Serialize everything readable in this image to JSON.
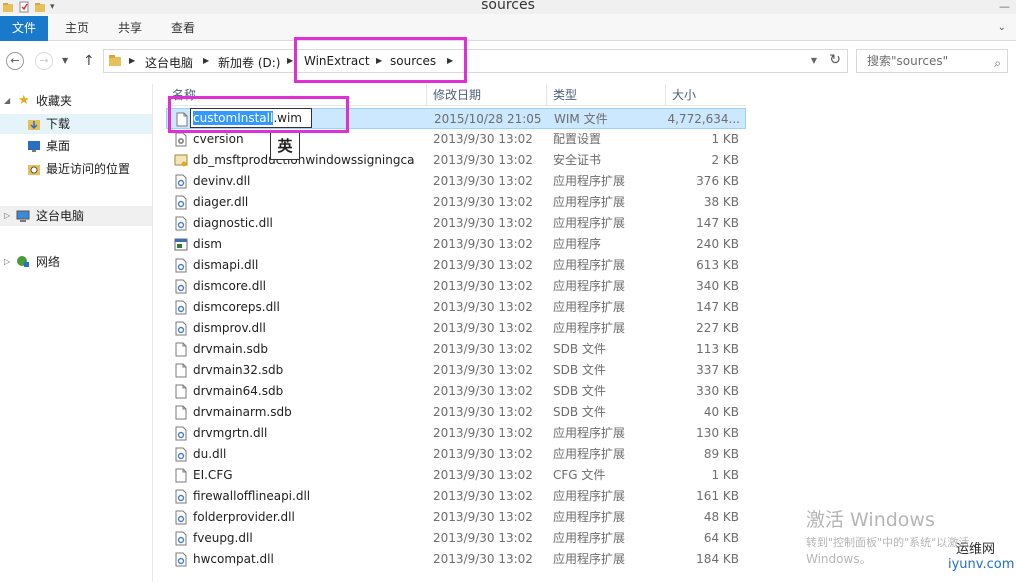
{
  "window": {
    "title": "sources"
  },
  "ribbon": {
    "tabs": [
      "文件",
      "主页",
      "共享",
      "查看"
    ]
  },
  "address": {
    "crumbs": [
      "这台电脑",
      "新加卷 (D:)",
      "WinExtract",
      "sources"
    ]
  },
  "search": {
    "placeholder": "搜索\"sources\""
  },
  "sidebar": {
    "favorites": "收藏夹",
    "downloads": "下载",
    "desktop": "桌面",
    "recent": "最近访问的位置",
    "this_pc": "这台电脑",
    "network": "网络"
  },
  "columns": {
    "name": "名称",
    "date": "修改日期",
    "type": "类型",
    "size": "大小"
  },
  "rename": {
    "selected_part": "customInstall",
    "extension": ".wim"
  },
  "ime": {
    "indicator": "英"
  },
  "files": [
    {
      "name": "customInstall.wim",
      "date": "2015/10/28 21:05",
      "type": "WIM 文件",
      "size": "4,772,634...",
      "icon": "blank-file-icon"
    },
    {
      "name": "cversion",
      "date": "2013/9/30 13:02",
      "type": "配置设置",
      "size": "1 KB",
      "icon": "settings-file-icon"
    },
    {
      "name": "db_msftproductionwindowssigningca",
      "date": "2013/9/30 13:02",
      "type": "安全证书",
      "size": "2 KB",
      "icon": "certificate-icon"
    },
    {
      "name": "devinv.dll",
      "date": "2013/9/30 13:02",
      "type": "应用程序扩展",
      "size": "376 KB",
      "icon": "dll-icon"
    },
    {
      "name": "diager.dll",
      "date": "2013/9/30 13:02",
      "type": "应用程序扩展",
      "size": "38 KB",
      "icon": "dll-icon"
    },
    {
      "name": "diagnostic.dll",
      "date": "2013/9/30 13:02",
      "type": "应用程序扩展",
      "size": "147 KB",
      "icon": "dll-icon"
    },
    {
      "name": "dism",
      "date": "2013/9/30 13:02",
      "type": "应用程序",
      "size": "240 KB",
      "icon": "application-icon"
    },
    {
      "name": "dismapi.dll",
      "date": "2013/9/30 13:02",
      "type": "应用程序扩展",
      "size": "613 KB",
      "icon": "dll-icon"
    },
    {
      "name": "dismcore.dll",
      "date": "2013/9/30 13:02",
      "type": "应用程序扩展",
      "size": "340 KB",
      "icon": "dll-icon"
    },
    {
      "name": "dismcoreps.dll",
      "date": "2013/9/30 13:02",
      "type": "应用程序扩展",
      "size": "147 KB",
      "icon": "dll-icon"
    },
    {
      "name": "dismprov.dll",
      "date": "2013/9/30 13:02",
      "type": "应用程序扩展",
      "size": "227 KB",
      "icon": "dll-icon"
    },
    {
      "name": "drvmain.sdb",
      "date": "2013/9/30 13:02",
      "type": "SDB 文件",
      "size": "113 KB",
      "icon": "blank-file-icon"
    },
    {
      "name": "drvmain32.sdb",
      "date": "2013/9/30 13:02",
      "type": "SDB 文件",
      "size": "337 KB",
      "icon": "blank-file-icon"
    },
    {
      "name": "drvmain64.sdb",
      "date": "2013/9/30 13:02",
      "type": "SDB 文件",
      "size": "330 KB",
      "icon": "blank-file-icon"
    },
    {
      "name": "drvmainarm.sdb",
      "date": "2013/9/30 13:02",
      "type": "SDB 文件",
      "size": "40 KB",
      "icon": "blank-file-icon"
    },
    {
      "name": "drvmgrtn.dll",
      "date": "2013/9/30 13:02",
      "type": "应用程序扩展",
      "size": "130 KB",
      "icon": "dll-icon"
    },
    {
      "name": "du.dll",
      "date": "2013/9/30 13:02",
      "type": "应用程序扩展",
      "size": "89 KB",
      "icon": "dll-icon"
    },
    {
      "name": "EI.CFG",
      "date": "2013/9/30 13:02",
      "type": "CFG 文件",
      "size": "1 KB",
      "icon": "blank-file-icon"
    },
    {
      "name": "firewallofflineapi.dll",
      "date": "2013/9/30 13:02",
      "type": "应用程序扩展",
      "size": "161 KB",
      "icon": "dll-icon"
    },
    {
      "name": "folderprovider.dll",
      "date": "2013/9/30 13:02",
      "type": "应用程序扩展",
      "size": "48 KB",
      "icon": "dll-icon"
    },
    {
      "name": "fveupg.dll",
      "date": "2013/9/30 13:02",
      "type": "应用程序扩展",
      "size": "64 KB",
      "icon": "dll-icon"
    },
    {
      "name": "hwcompat.dll",
      "date": "2013/9/30 13:02",
      "type": "应用程序扩展",
      "size": "184 KB",
      "icon": "dll-icon"
    }
  ],
  "watermark": {
    "line1": "激活 Windows",
    "line2": "转到\"控制面板\"中的\"系统\"以激活",
    "line3": "Windows。"
  },
  "logo": {
    "top": "运维网",
    "bottom": "iyunv.com"
  },
  "colors": {
    "accent": "#1979ca",
    "highlight": "#df2fd5",
    "selection": "#cce8ff",
    "header_text": "#4c607a"
  }
}
